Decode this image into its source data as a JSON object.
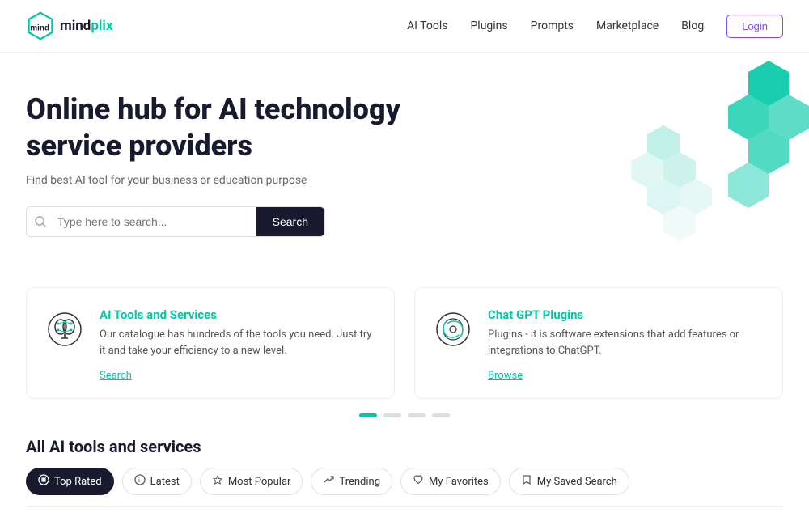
{
  "logo": {
    "text_mind": "mind",
    "text_plix": "plix"
  },
  "nav": {
    "links": [
      "AI Tools",
      "Plugins",
      "Prompts",
      "Marketplace",
      "Blog"
    ],
    "login_label": "Login"
  },
  "hero": {
    "title_line1": "Online hub for AI technology",
    "title_line2": "service providers",
    "subtitle": "Find best AI tool for your business or education purpose",
    "search_placeholder": "Type here to search...",
    "search_button_label": "Search"
  },
  "cards": [
    {
      "title": "AI Tools and Services",
      "description": "Our catalogue has hundreds of the tools you need. Just try it and take your efficiency to a new level.",
      "link_label": "Search"
    },
    {
      "title": "Chat GPT Plugins",
      "description": "Plugins - it is software extensions that add features or integrations to ChatGPT.",
      "link_label": "Browse"
    }
  ],
  "dots": [
    {
      "active": true
    },
    {
      "active": false
    },
    {
      "active": false
    },
    {
      "active": false
    }
  ],
  "bottom": {
    "title": "All AI tools and services",
    "tabs": [
      {
        "label": "Top Rated",
        "icon": "⊘",
        "active": true
      },
      {
        "label": "Latest",
        "icon": "ℹ",
        "active": false
      },
      {
        "label": "Most Popular",
        "icon": "★",
        "active": false
      },
      {
        "label": "Trending",
        "icon": "↗",
        "active": false
      },
      {
        "label": "My Favorites",
        "icon": "♡",
        "active": false
      },
      {
        "label": "My Saved Search",
        "icon": "🔖",
        "active": false
      }
    ]
  }
}
